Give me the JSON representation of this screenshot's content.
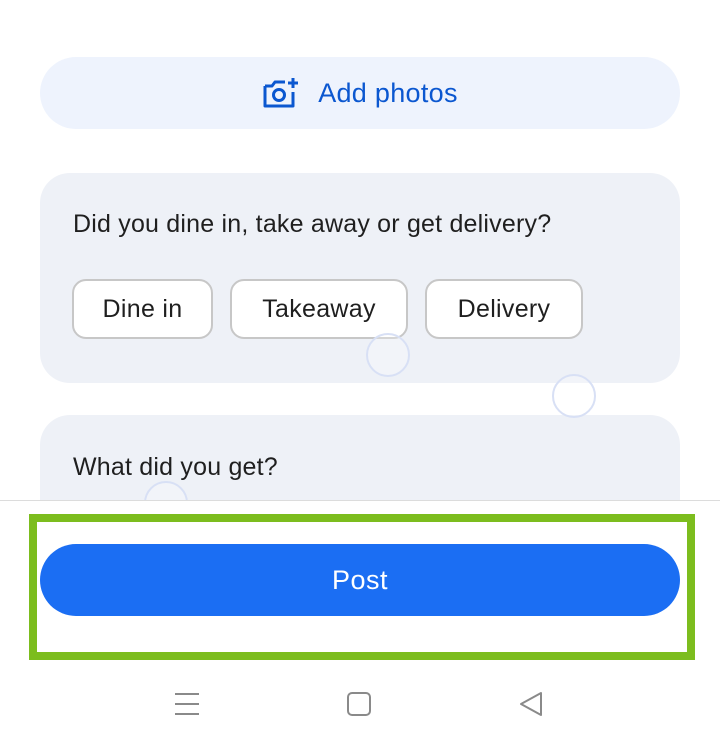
{
  "add_photos": {
    "label": "Add photos",
    "icon": "add-photo-camera-icon",
    "color": "#0b57d0"
  },
  "dine_question": {
    "text": "Did you dine in, take away or get delivery?",
    "options": [
      "Dine in",
      "Takeaway",
      "Delivery"
    ]
  },
  "get_question": {
    "text": "What did you get?"
  },
  "post_button": {
    "label": "Post",
    "color": "#1b6ef3"
  },
  "highlight_color": "#7cbd1e",
  "navbar": {
    "icons": [
      "menu-icon",
      "home-square-icon",
      "back-triangle-icon"
    ]
  }
}
